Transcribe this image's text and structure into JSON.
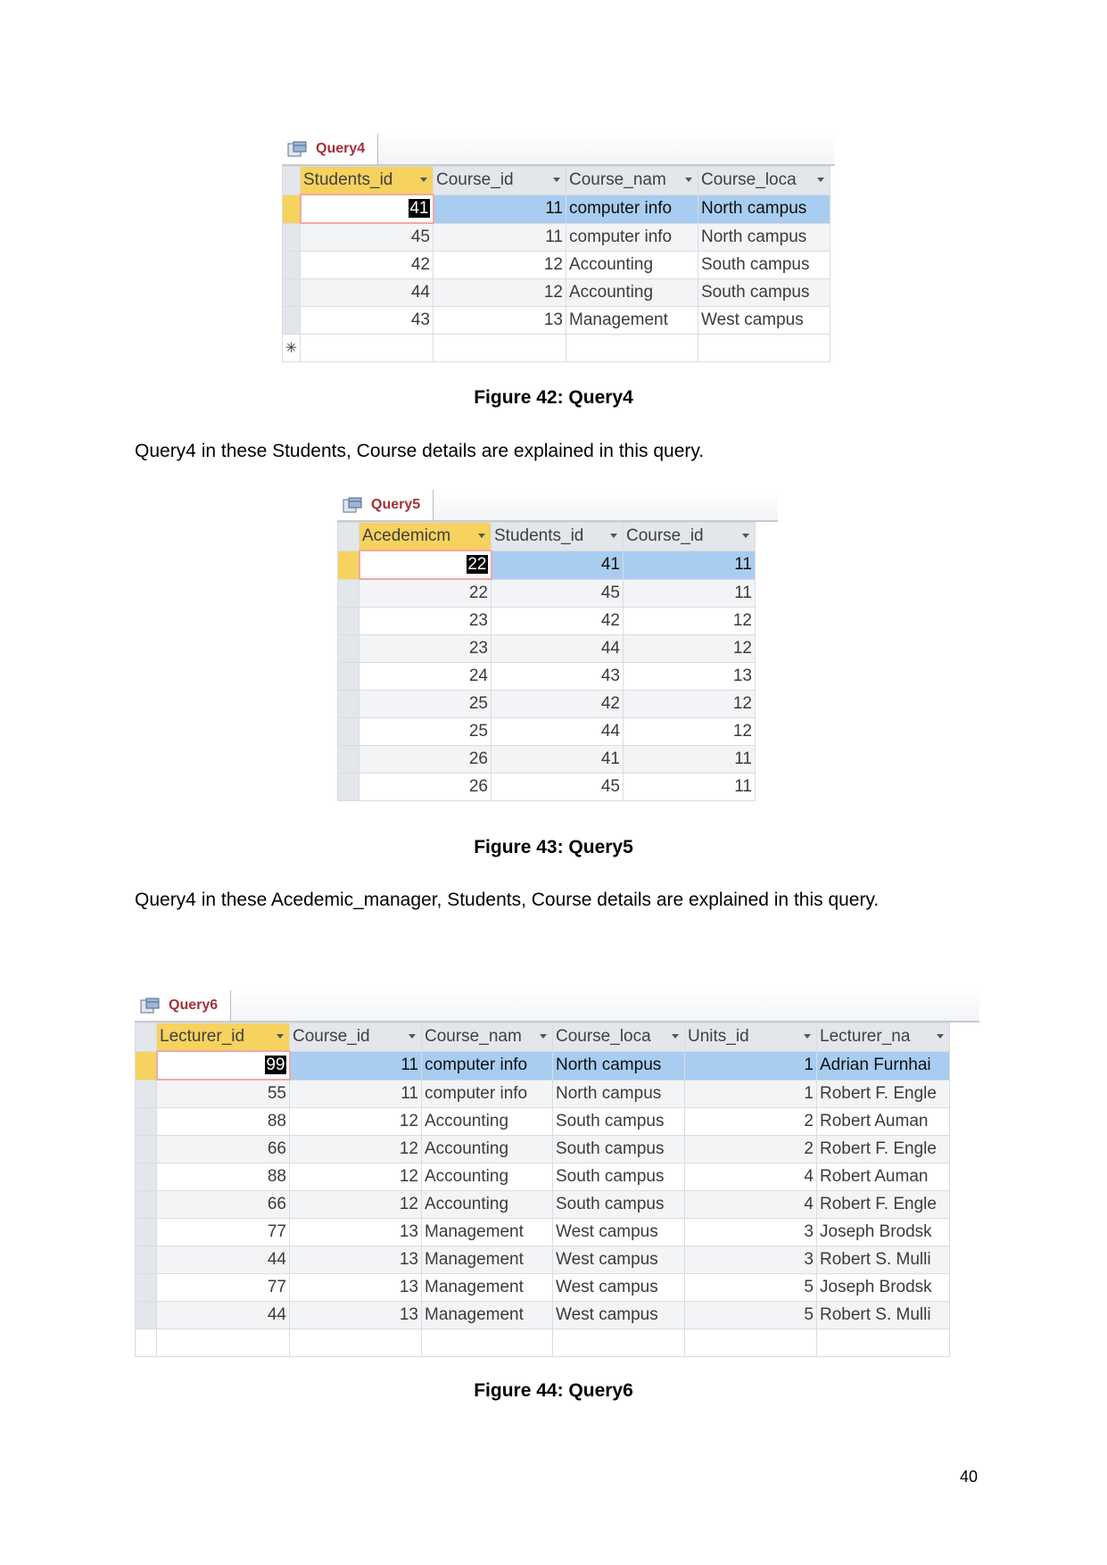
{
  "figures": [
    {
      "tab": "Query4",
      "columns": [
        "Students_id",
        "Course_id",
        "Course_nam",
        "Course_loca"
      ],
      "numeric": [
        true,
        true,
        false,
        false
      ],
      "rows": [
        [
          "41",
          "11",
          "computer info",
          "North campus"
        ],
        [
          "45",
          "11",
          "computer info",
          "North campus"
        ],
        [
          "42",
          "12",
          "Accounting",
          "South campus"
        ],
        [
          "44",
          "12",
          "Accounting",
          "South campus"
        ],
        [
          "43",
          "13",
          "Management",
          "West campus"
        ]
      ],
      "new_row_marker": "✳",
      "caption": "Figure 42: Query4"
    },
    {
      "tab": "Query5",
      "columns": [
        "Acedemicm",
        "Students_id",
        "Course_id"
      ],
      "numeric": [
        true,
        true,
        true
      ],
      "rows": [
        [
          "22",
          "41",
          "11"
        ],
        [
          "22",
          "45",
          "11"
        ],
        [
          "23",
          "42",
          "12"
        ],
        [
          "23",
          "44",
          "12"
        ],
        [
          "24",
          "43",
          "13"
        ],
        [
          "25",
          "42",
          "12"
        ],
        [
          "25",
          "44",
          "12"
        ],
        [
          "26",
          "41",
          "11"
        ],
        [
          "26",
          "45",
          "11"
        ]
      ],
      "caption": "Figure 43: Query5"
    },
    {
      "tab": "Query6",
      "columns": [
        "Lecturer_id",
        "Course_id",
        "Course_nam",
        "Course_loca",
        "Units_id",
        "Lecturer_na"
      ],
      "numeric": [
        true,
        true,
        false,
        false,
        true,
        false
      ],
      "rows": [
        [
          "99",
          "11",
          "computer info",
          "North campus",
          "1",
          "Adrian Furnhai"
        ],
        [
          "55",
          "11",
          "computer info",
          "North campus",
          "1",
          "Robert F. Engle"
        ],
        [
          "88",
          "12",
          "Accounting",
          "South campus",
          "2",
          "Robert Auman"
        ],
        [
          "66",
          "12",
          "Accounting",
          "South campus",
          "2",
          "Robert F. Engle"
        ],
        [
          "88",
          "12",
          "Accounting",
          "South campus",
          "4",
          "Robert Auman"
        ],
        [
          "66",
          "12",
          "Accounting",
          "South campus",
          "4",
          "Robert F. Engle"
        ],
        [
          "77",
          "13",
          "Management",
          "West campus",
          "3",
          "Joseph Brodsk"
        ],
        [
          "44",
          "13",
          "Management",
          "West campus",
          "3",
          "Robert S. Mulli"
        ],
        [
          "77",
          "13",
          "Management",
          "West campus",
          "5",
          "Joseph Brodsk"
        ],
        [
          "44",
          "13",
          "Management",
          "West campus",
          "5",
          "Robert S. Mulli"
        ]
      ],
      "caption": "Figure 44: Query6"
    }
  ],
  "paragraphs": [
    "Query4 in these Students, Course details are explained in this query.",
    "Query4 in these Acedemic_manager, Students, Course details are explained in this query."
  ],
  "page_number": "40",
  "colors": {
    "header_active": "#f6d25e",
    "selected_row": "#a8cdf0",
    "tab_text": "#a3303a"
  }
}
